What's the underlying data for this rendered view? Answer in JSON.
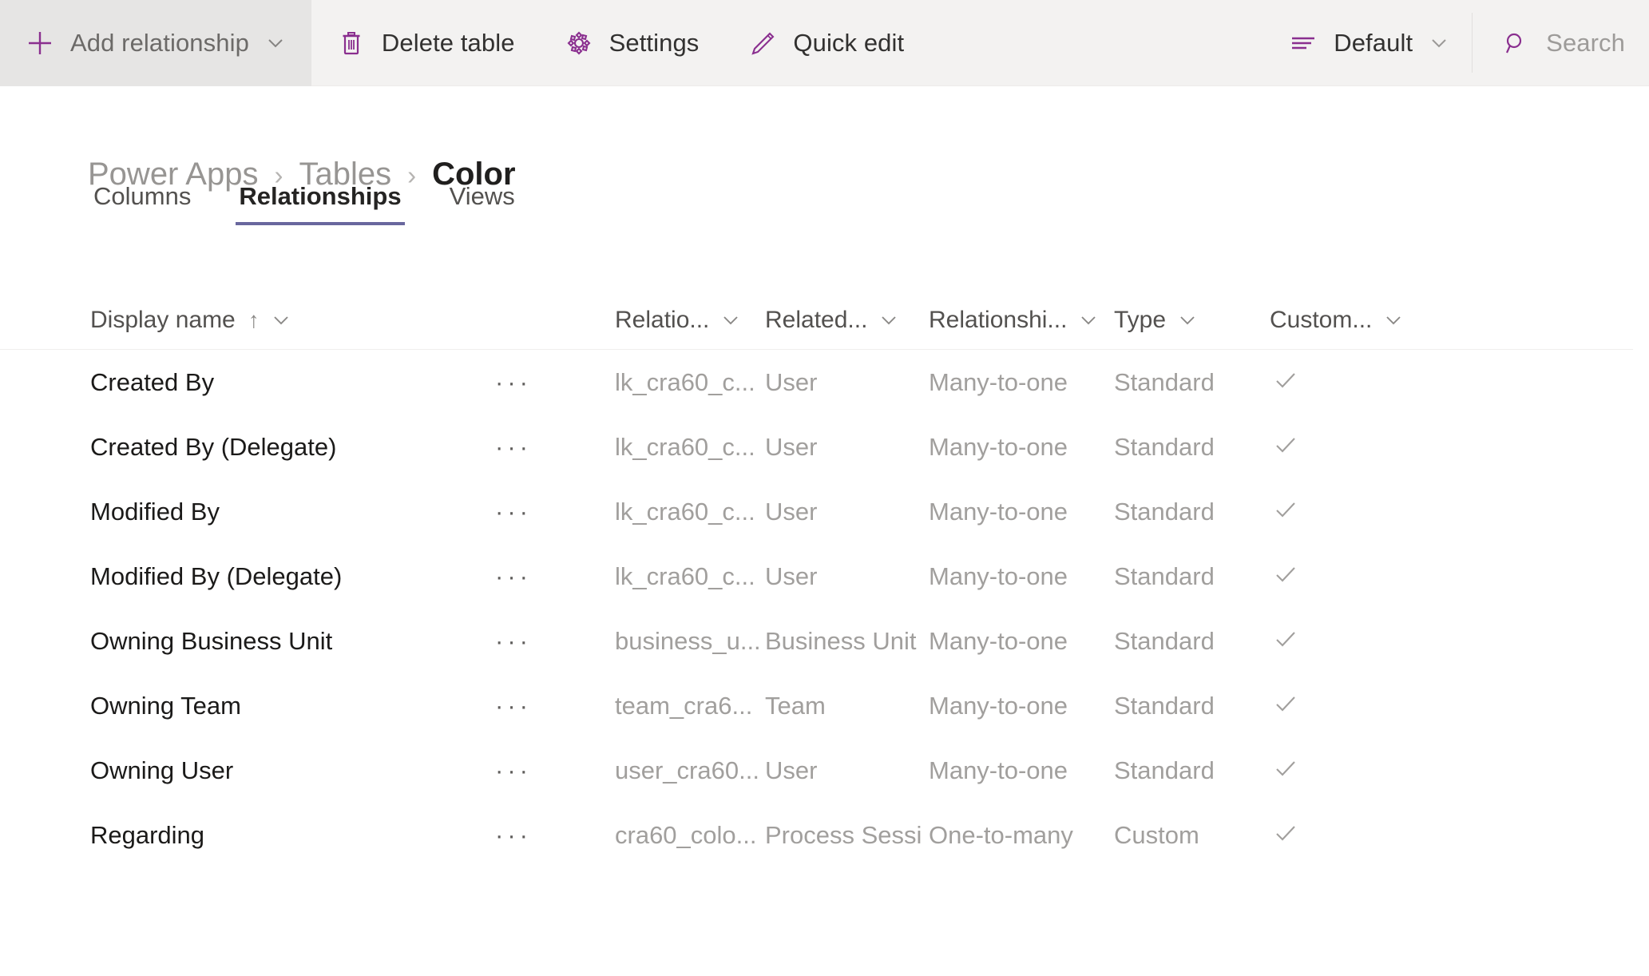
{
  "commandbar": {
    "buttons": [
      {
        "label": "Add relationship",
        "icon": "plus-icon",
        "has_chevron": true,
        "active": true,
        "muted": true
      },
      {
        "label": "Delete table",
        "icon": "trash-icon",
        "has_chevron": false,
        "active": false,
        "muted": false
      },
      {
        "label": "Settings",
        "icon": "gear-icon",
        "has_chevron": false,
        "active": false,
        "muted": false
      },
      {
        "label": "Quick edit",
        "icon": "pencil-icon",
        "has_chevron": false,
        "active": false,
        "muted": false
      }
    ],
    "view_selector": {
      "label": "Default",
      "icon": "view-list-icon",
      "has_chevron": true
    },
    "search": {
      "placeholder": "Search",
      "value": "",
      "icon": "search-icon"
    }
  },
  "breadcrumb": {
    "items": [
      "Power Apps",
      "Tables",
      "Color"
    ],
    "separator": "›",
    "current_index": 2
  },
  "tabs": {
    "items": [
      "Columns",
      "Relationships",
      "Views"
    ],
    "selected": "Relationships"
  },
  "grid": {
    "columns": [
      {
        "label": "Display name",
        "sorted": true,
        "sort_arrow": "↑"
      },
      {
        "label": "Relatio...",
        "sorted": false
      },
      {
        "label": "Related...",
        "sorted": false
      },
      {
        "label": "Relationshi...",
        "sorted": false
      },
      {
        "label": "Type",
        "sorted": false
      },
      {
        "label": "Custom...",
        "sorted": false
      }
    ],
    "rows": [
      {
        "display_name": "Created By",
        "relationship_name": "lk_cra60_c...",
        "related_table": "User",
        "relationship_type": "Many-to-one",
        "type": "Standard",
        "customizable": true
      },
      {
        "display_name": "Created By (Delegate)",
        "relationship_name": "lk_cra60_c...",
        "related_table": "User",
        "relationship_type": "Many-to-one",
        "type": "Standard",
        "customizable": true
      },
      {
        "display_name": "Modified By",
        "relationship_name": "lk_cra60_c...",
        "related_table": "User",
        "relationship_type": "Many-to-one",
        "type": "Standard",
        "customizable": true
      },
      {
        "display_name": "Modified By (Delegate)",
        "relationship_name": "lk_cra60_c...",
        "related_table": "User",
        "relationship_type": "Many-to-one",
        "type": "Standard",
        "customizable": true
      },
      {
        "display_name": "Owning Business Unit",
        "relationship_name": "business_u...",
        "related_table": "Business Unit",
        "relationship_type": "Many-to-one",
        "type": "Standard",
        "customizable": true
      },
      {
        "display_name": "Owning Team",
        "relationship_name": "team_cra6...",
        "related_table": "Team",
        "relationship_type": "Many-to-one",
        "type": "Standard",
        "customizable": true
      },
      {
        "display_name": "Owning User",
        "relationship_name": "user_cra60...",
        "related_table": "User",
        "relationship_type": "Many-to-one",
        "type": "Standard",
        "customizable": true
      },
      {
        "display_name": "Regarding",
        "relationship_name": "cra60_colo...",
        "related_table": "Process Sessi",
        "relationship_type": "One-to-many",
        "type": "Custom",
        "customizable": true
      }
    ],
    "row_menu_glyph": "···",
    "check_glyph": "✓"
  },
  "colors": {
    "accent_purple": "#8a2f8f",
    "tab_underline": "#69679e",
    "commandbar_bg": "#f3f2f1",
    "active_btn_bg": "#e6e5e4",
    "text_primary": "#1b1a19",
    "text_muted": "#a19f9d"
  }
}
